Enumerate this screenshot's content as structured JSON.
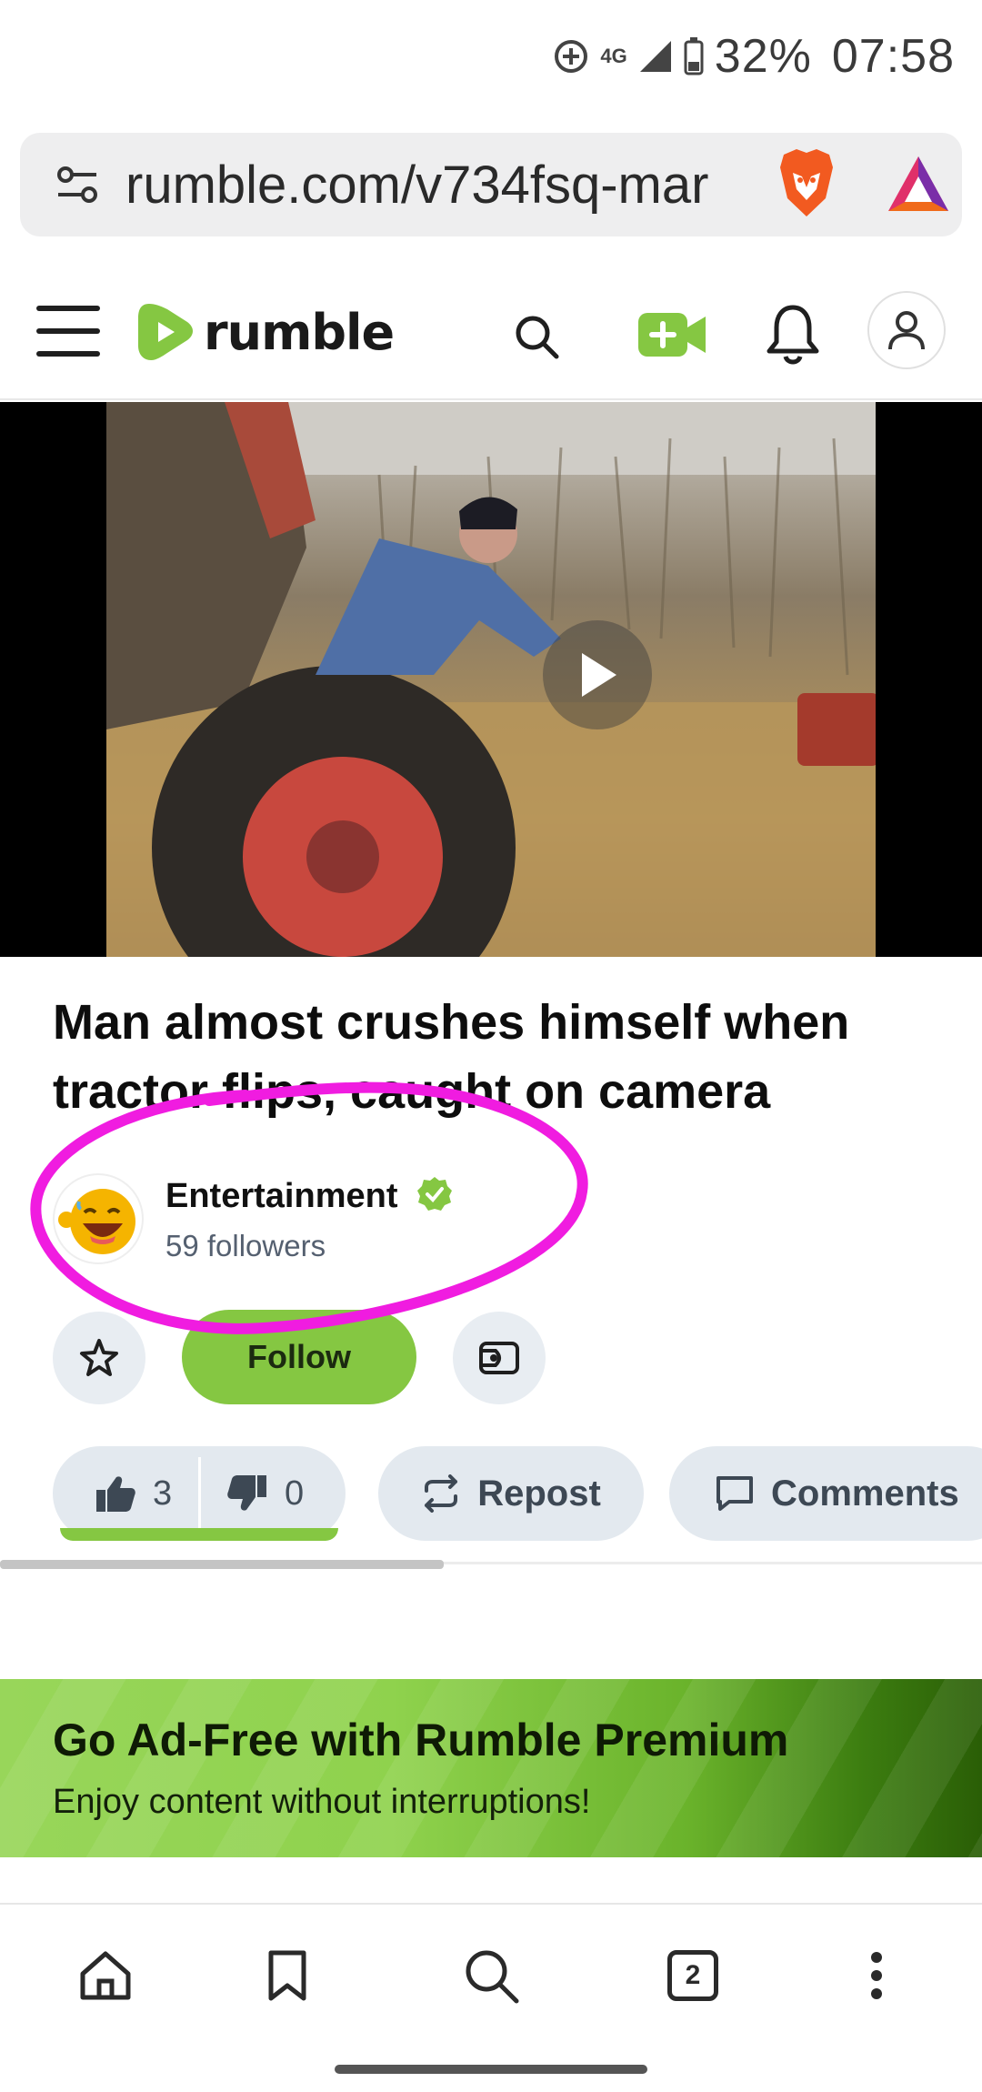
{
  "status_bar": {
    "network": "4G",
    "battery": "32%",
    "time": "07:58"
  },
  "browser": {
    "url": "rumble.com/v734fsq-mar"
  },
  "header": {
    "logo_text": "rumble",
    "brand_color": "#85c742"
  },
  "video": {
    "title": "Man almost crushes himself when tractor flips, caught on camera"
  },
  "channel": {
    "name": "Entertainment",
    "followers": "59 followers",
    "verified": true
  },
  "actions": {
    "follow_label": "Follow",
    "likes": "3",
    "dislikes": "0",
    "repost_label": "Repost",
    "comments_label": "Comments"
  },
  "promo": {
    "title": "Go Ad-Free with Rumble Premium",
    "subtitle": "Enjoy content without interruptions!"
  },
  "bottom_nav": {
    "tab_count": "2"
  },
  "icons": [
    "hotspot-icon",
    "signal-icon",
    "battery-icon",
    "site-settings-icon",
    "brave-shields-icon",
    "brave-rewards-icon",
    "menu-icon",
    "search-icon",
    "upload-video-icon",
    "notifications-bell-icon",
    "user-account-icon",
    "play-icon",
    "verified-badge-icon",
    "star-icon",
    "rant-icon",
    "thumbs-up-icon",
    "thumbs-down-icon",
    "repost-icon",
    "comment-icon",
    "home-icon",
    "bookmark-icon",
    "tabs-icon",
    "more-menu-icon"
  ],
  "annotation_color": "#f01ce0"
}
